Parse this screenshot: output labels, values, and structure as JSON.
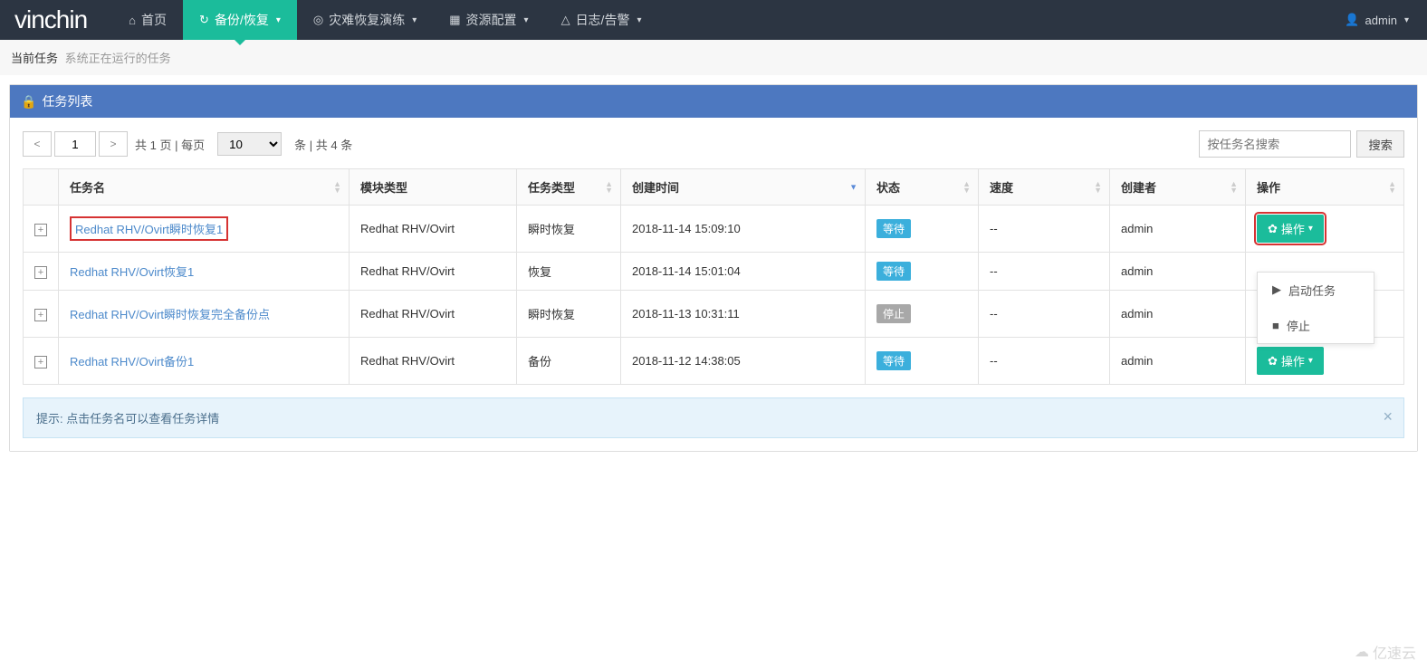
{
  "brand": "vinchin",
  "nav": {
    "home": "首页",
    "backup": "备份/恢复",
    "disaster": "灾难恢复演练",
    "resource": "资源配置",
    "log": "日志/告警",
    "user": "admin"
  },
  "breadcrumb": {
    "title": "当前任务",
    "sub": "系统正在运行的任务"
  },
  "panel_title": "任务列表",
  "toolbar": {
    "page_input": "1",
    "page_total_prefix": "共",
    "page_total_suffix": "页 | 每页",
    "page_total": "1",
    "page_size": "10",
    "records_prefix": "条 | 共",
    "records": "4",
    "records_suffix": "条",
    "search_placeholder": "按任务名搜索",
    "search_btn": "搜索"
  },
  "columns": {
    "name": "任务名",
    "module": "模块类型",
    "type": "任务类型",
    "time": "创建时间",
    "status": "状态",
    "speed": "速度",
    "creator": "创建者",
    "action": "操作"
  },
  "rows": [
    {
      "name": "Redhat RHV/Ovirt瞬时恢复1",
      "module": "Redhat RHV/Ovirt",
      "type": "瞬时恢复",
      "time": "2018-11-14 15:09:10",
      "status": "等待",
      "status_kind": "wait",
      "speed": "--",
      "creator": "admin",
      "highlight_name": true,
      "highlight_action": true,
      "show_dropdown": false
    },
    {
      "name": "Redhat RHV/Ovirt恢复1",
      "module": "Redhat RHV/Ovirt",
      "type": "恢复",
      "time": "2018-11-14 15:01:04",
      "status": "等待",
      "status_kind": "wait",
      "speed": "--",
      "creator": "admin",
      "highlight_name": false,
      "highlight_action": false,
      "show_dropdown": true
    },
    {
      "name": "Redhat RHV/Ovirt瞬时恢复完全备份点",
      "module": "Redhat RHV/Ovirt",
      "type": "瞬时恢复",
      "time": "2018-11-13 10:31:11",
      "status": "停止",
      "status_kind": "stop",
      "speed": "--",
      "creator": "admin",
      "highlight_name": false,
      "highlight_action": false,
      "show_dropdown": false
    },
    {
      "name": "Redhat RHV/Ovirt备份1",
      "module": "Redhat RHV/Ovirt",
      "type": "备份",
      "time": "2018-11-12 14:38:05",
      "status": "等待",
      "status_kind": "wait",
      "speed": "--",
      "creator": "admin",
      "highlight_name": false,
      "highlight_action": false,
      "show_dropdown": false
    }
  ],
  "action_btn_label": "操作",
  "dropdown": {
    "start": "启动任务",
    "stop": "停止"
  },
  "info": "提示: 点击任务名可以查看任务详情",
  "watermark": "亿速云"
}
